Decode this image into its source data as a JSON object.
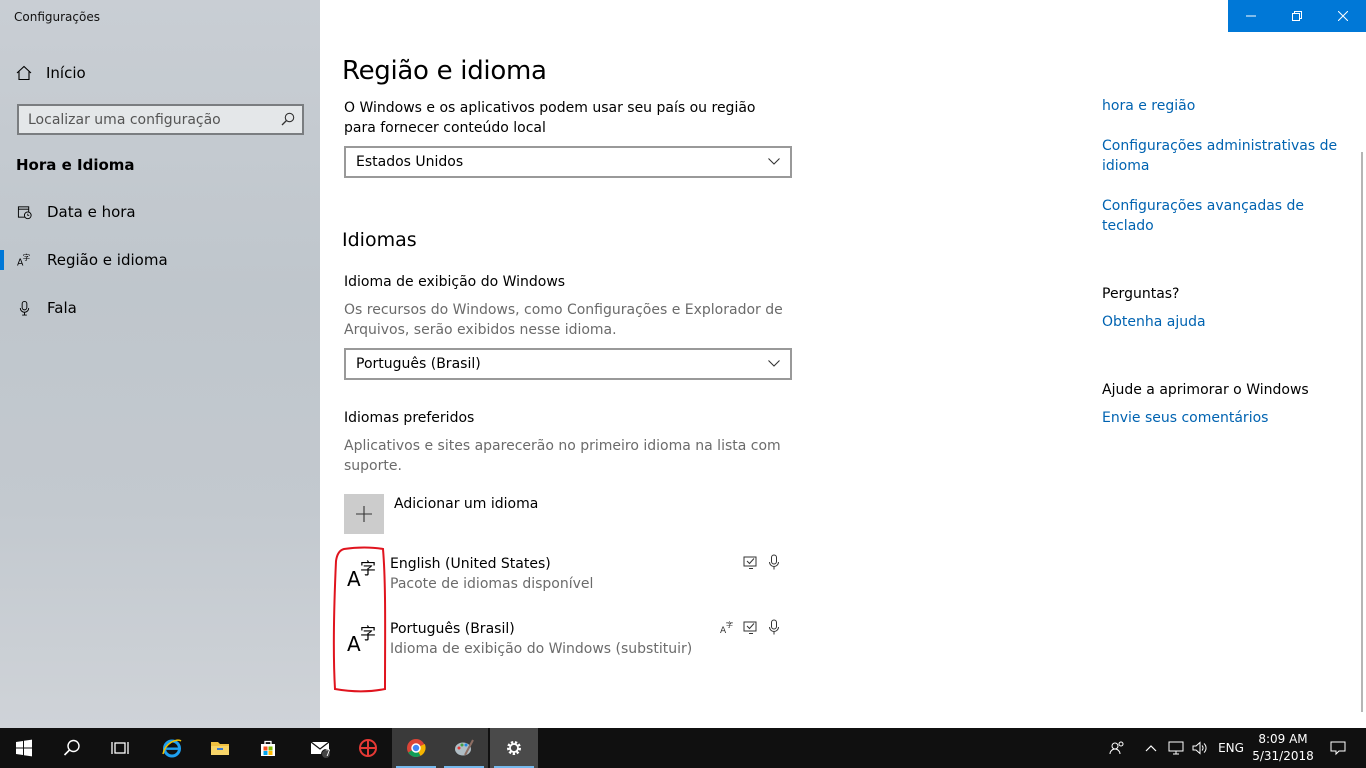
{
  "window": {
    "title": "Configurações"
  },
  "sidebar": {
    "home": "Início",
    "search_placeholder": "Localizar uma configuração",
    "section": "Hora e Idioma",
    "items": [
      {
        "label": "Data e hora",
        "icon": "calendar-clock-icon"
      },
      {
        "label": "Região e idioma",
        "icon": "language-icon",
        "active": true
      },
      {
        "label": "Fala",
        "icon": "microphone-icon"
      }
    ]
  },
  "main": {
    "title": "Região e idioma",
    "region_desc": "O Windows e os aplicativos podem usar seu país ou região para fornecer conteúdo local",
    "region_value": "Estados Unidos",
    "languages_heading": "Idiomas",
    "display_lang_label": "Idioma de exibição do Windows",
    "display_lang_desc": "Os recursos do Windows, como Configurações e Explorador de Arquivos, serão exibidos nesse idioma.",
    "display_lang_value": "Português (Brasil)",
    "preferred_label": "Idiomas preferidos",
    "preferred_desc": "Aplicativos e sites aparecerão no primeiro idioma na lista com suporte.",
    "add_language": "Adicionar um idioma",
    "languages": [
      {
        "name": "English (United States)",
        "status": "Pacote de idiomas disponível"
      },
      {
        "name": "Português (Brasil)",
        "status": "Idioma de exibição do Windows (substituir)"
      }
    ]
  },
  "related": {
    "link_date_region": "hora e região",
    "link_admin": "Configurações administrativas de idioma",
    "link_keyboard": "Configurações avançadas de teclado",
    "questions_label": "Perguntas?",
    "help_link": "Obtenha ajuda",
    "improve_label": "Ajude a aprimorar o Windows",
    "feedback_link": "Envie seus comentários"
  },
  "taskbar": {
    "mail_badge": "7",
    "lang": "ENG",
    "time": "8:09 AM",
    "date": "5/31/2018"
  },
  "colors": {
    "accent": "#0078d7",
    "link": "#0063b1",
    "annotation": "#e0141e"
  }
}
